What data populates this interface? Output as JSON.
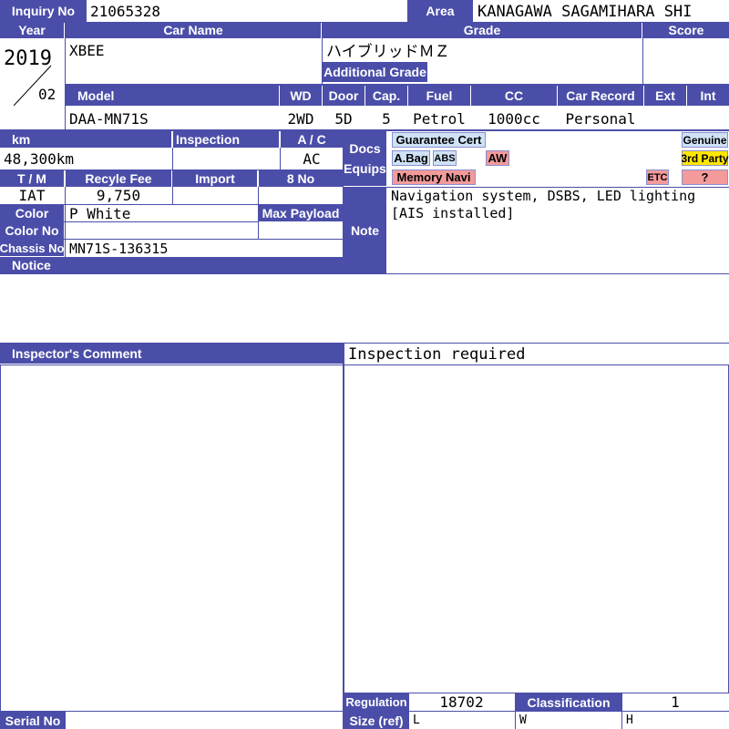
{
  "sheet": {
    "inquiry": {
      "label": "Inquiry No",
      "value": "21065328"
    },
    "area": {
      "label": "Area",
      "value": "KANAGAWA SAGAMIHARA SHI"
    },
    "year": {
      "label": "Year",
      "year": "2019",
      "month": "02"
    },
    "car_name": {
      "label": "Car Name",
      "value": "XBEE"
    },
    "grade": {
      "label": "Grade",
      "value": "ハイブリッドＭＺ",
      "additional_label": "Additional Grade",
      "additional_value": ""
    },
    "score": {
      "label": "Score",
      "value": ""
    },
    "model": {
      "label": "Model",
      "value": "DAA-MN71S"
    },
    "wd": {
      "label": "WD",
      "value": "2WD"
    },
    "door": {
      "label": "Door",
      "value": "5D"
    },
    "cap": {
      "label": "Cap.",
      "value": "5"
    },
    "fuel": {
      "label": "Fuel",
      "value": "Petrol"
    },
    "cc": {
      "label": "CC",
      "value": "1000cc"
    },
    "car_record": {
      "label": "Car Record",
      "value": "Personal"
    },
    "ext": {
      "label": "Ext",
      "value": ""
    },
    "int": {
      "label": "Int",
      "value": ""
    },
    "km": {
      "label": "km",
      "value": "48,300km"
    },
    "inspection": {
      "label": "Inspection",
      "value": ""
    },
    "ac": {
      "label": "A / C",
      "value": "AC"
    },
    "tm": {
      "label": "T / M",
      "value": "IAT"
    },
    "recycle_fee": {
      "label": "Recyle Fee",
      "value": "9,750"
    },
    "import": {
      "label": "Import",
      "value": ""
    },
    "eight_no": {
      "label": "8 No",
      "value": ""
    },
    "color": {
      "label": "Color",
      "value": "P White"
    },
    "max_payload": {
      "label": "Max Payload",
      "value": ""
    },
    "color_no": {
      "label": "Color No",
      "value": ""
    },
    "chassis_no": {
      "label": "Chassis No",
      "value": "MN71S-136315"
    },
    "notice": {
      "label": "Notice"
    },
    "docs_equips": {
      "label_line1": "Docs",
      "label_line2": "Equips"
    },
    "equip_badges": {
      "guarantee_cert": "Guarantee Cert",
      "genuine": "Genuine",
      "abag": "A.Bag",
      "abs": "ABS",
      "aw": "AW",
      "third_party": "3rd Party",
      "memory_navi": "Memory Navi",
      "etc": "ETC",
      "question": "?"
    },
    "note": {
      "label": "Note",
      "line1": "Navigation system, DSBS, LED lighting",
      "line2": "[AIS installed]"
    },
    "inspector_comment": {
      "label": "Inspector's Comment",
      "value": "Inspection required"
    },
    "regulation": {
      "label": "Regulation",
      "value": "18702"
    },
    "classification": {
      "label": "Classification",
      "value": "1"
    },
    "size_ref": {
      "label": "Size (ref)",
      "l": "L",
      "w": "W",
      "h": "H"
    },
    "serial_no": {
      "label": "Serial No",
      "value": ""
    }
  },
  "colors": {
    "header": "#4b4ea8",
    "badge_blue": "#cfe2f6",
    "badge_red": "#f39a9a",
    "badge_yellow": "#ffe600"
  }
}
